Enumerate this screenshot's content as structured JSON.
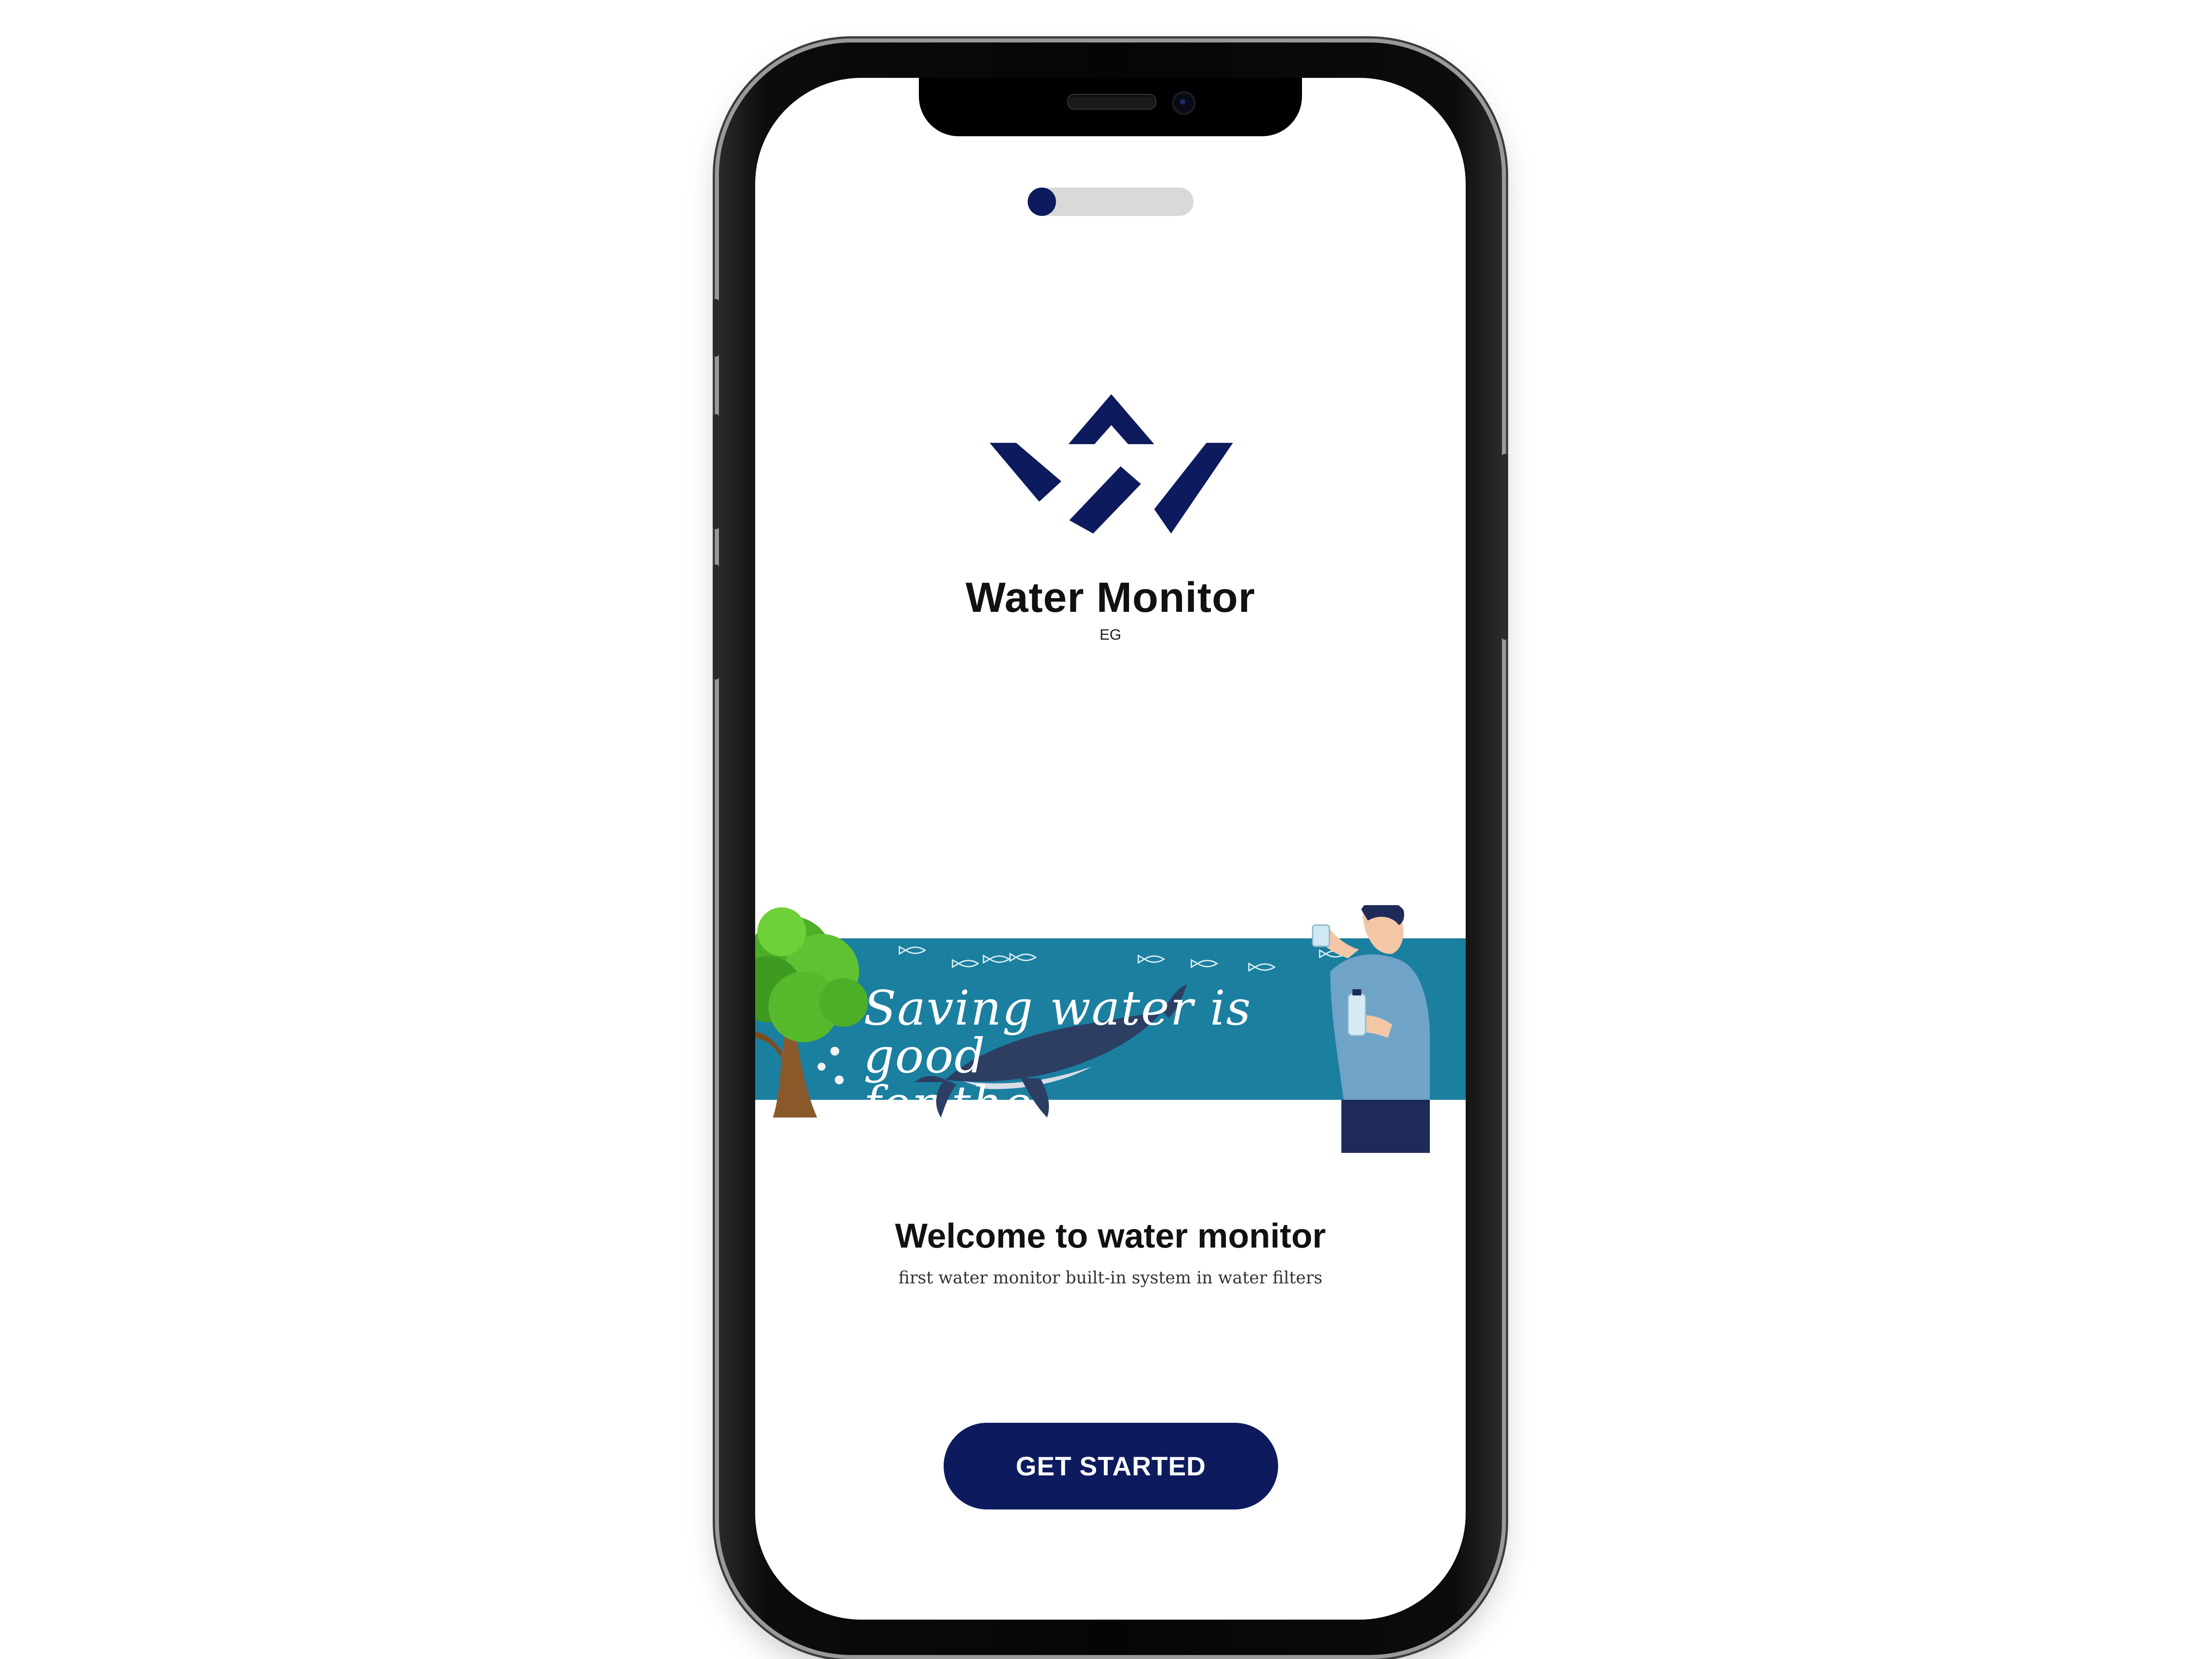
{
  "theme": {
    "brand_color": "#0d1b5e",
    "banner_color": "#1b7fa0",
    "track_color": "#d9d9d9"
  },
  "onboarding": {
    "progress": 0.1
  },
  "brand": {
    "name": "Water Monitor",
    "sub": "EG",
    "logo_icon": "w-logo-icon"
  },
  "banner": {
    "line1": "Saving water is good",
    "line2": "for the environment"
  },
  "welcome": {
    "title": "Welcome to water monitor",
    "subtitle": "first water monitor built-in system in water filters"
  },
  "cta": {
    "label": "GET STARTED"
  }
}
